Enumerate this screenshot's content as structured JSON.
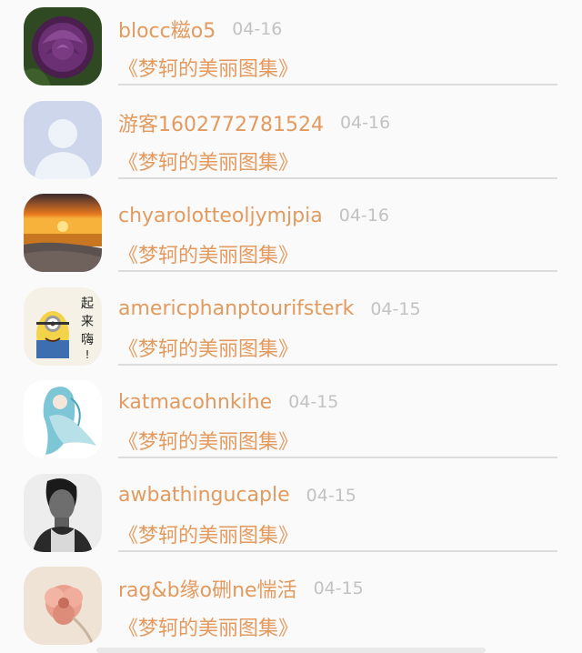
{
  "comments": [
    {
      "username": "blocc糍o5",
      "date": "04-16",
      "album": "《梦轲的美丽图集》",
      "avatar": "purple-rose-avatar"
    },
    {
      "username": "游客1602772781524",
      "date": "04-16",
      "album": "《梦轲的美丽图集》",
      "avatar": "default-user-avatar"
    },
    {
      "username": "chyarolotteoljymjpia",
      "date": "04-16",
      "album": "《梦轲的美丽图集》",
      "avatar": "sunset-beach-avatar"
    },
    {
      "username": "americphanptourifsterk",
      "date": "04-15",
      "album": "《梦轲的美丽图集》",
      "avatar": "minion-avatar",
      "avatar_text": "起来嗨!"
    },
    {
      "username": "katmacohnkihe",
      "date": "04-15",
      "album": "《梦轲的美丽图集》",
      "avatar": "anime-girl-avatar"
    },
    {
      "username": "awbathingucaple",
      "date": "04-15",
      "album": "《梦轲的美丽图集》",
      "avatar": "man-portrait-avatar"
    },
    {
      "username": "rag&b缘o硎ne惴活",
      "date": "04-15",
      "album": "《梦轲的美丽图集》",
      "avatar": "pink-flower-avatar"
    }
  ],
  "colors": {
    "accent": "#e39a5e",
    "date": "#c2c2c2",
    "divider": "#dcdcdc",
    "background": "#fbfafa"
  }
}
